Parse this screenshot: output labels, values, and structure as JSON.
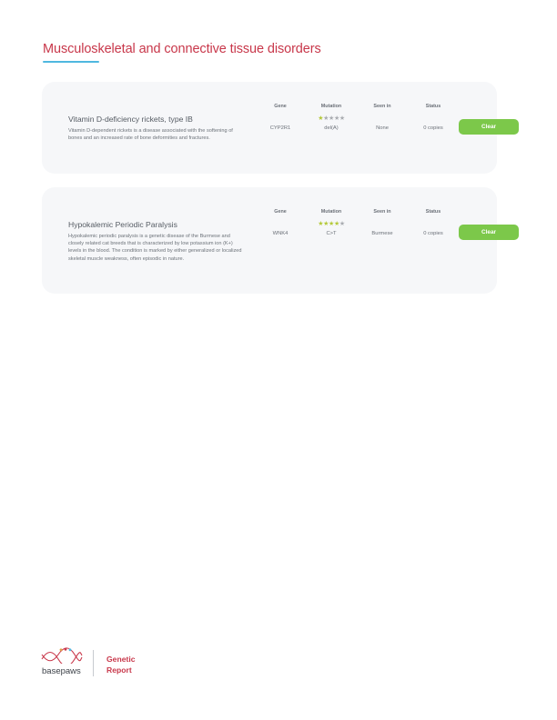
{
  "section": {
    "title": "Musculoskeletal and connective tissue disorders"
  },
  "columns": {
    "gene": "Gene",
    "mutation": "Mutation",
    "seen_in": "Seen in",
    "status": "Status"
  },
  "colors": {
    "accent_red": "#c8374a",
    "accent_blue": "#4fb8e0",
    "status_green": "#7cc84a",
    "star_on": "#b5c93a",
    "star_off": "#a9acb1"
  },
  "conditions": [
    {
      "name": "Vitamin D-deficiency rickets, type IB",
      "description": "Vitamin D-dependent rickets is a disease associated with the softening of bones and an increased rate of bone deformities and fractures.",
      "gene": "CYP2R1",
      "mutation": "del(A)",
      "mutation_rating": 1,
      "mutation_rating_max": 5,
      "seen_in": "None",
      "status": "0 copies",
      "result": "Clear"
    },
    {
      "name": "Hypokalemic Periodic Paralysis",
      "description": "Hypokalemic periodic paralysis is a genetic disease of the Burmese and closely related cat breeds that is characterized by low potassium ion (K+) levels in the blood. The condition is marked by either generalized or localized skeletal muscle weakness, often episodic in nature.",
      "gene": "WNK4",
      "mutation": "C>T",
      "mutation_rating": 4,
      "mutation_rating_max": 5,
      "seen_in": "Burmese",
      "status": "0 copies",
      "result": "Clear"
    }
  ],
  "footer": {
    "logo_icon": "dna-helix-icon",
    "brand": "basepaws",
    "report_line1": "Genetic",
    "report_line2": "Report"
  }
}
